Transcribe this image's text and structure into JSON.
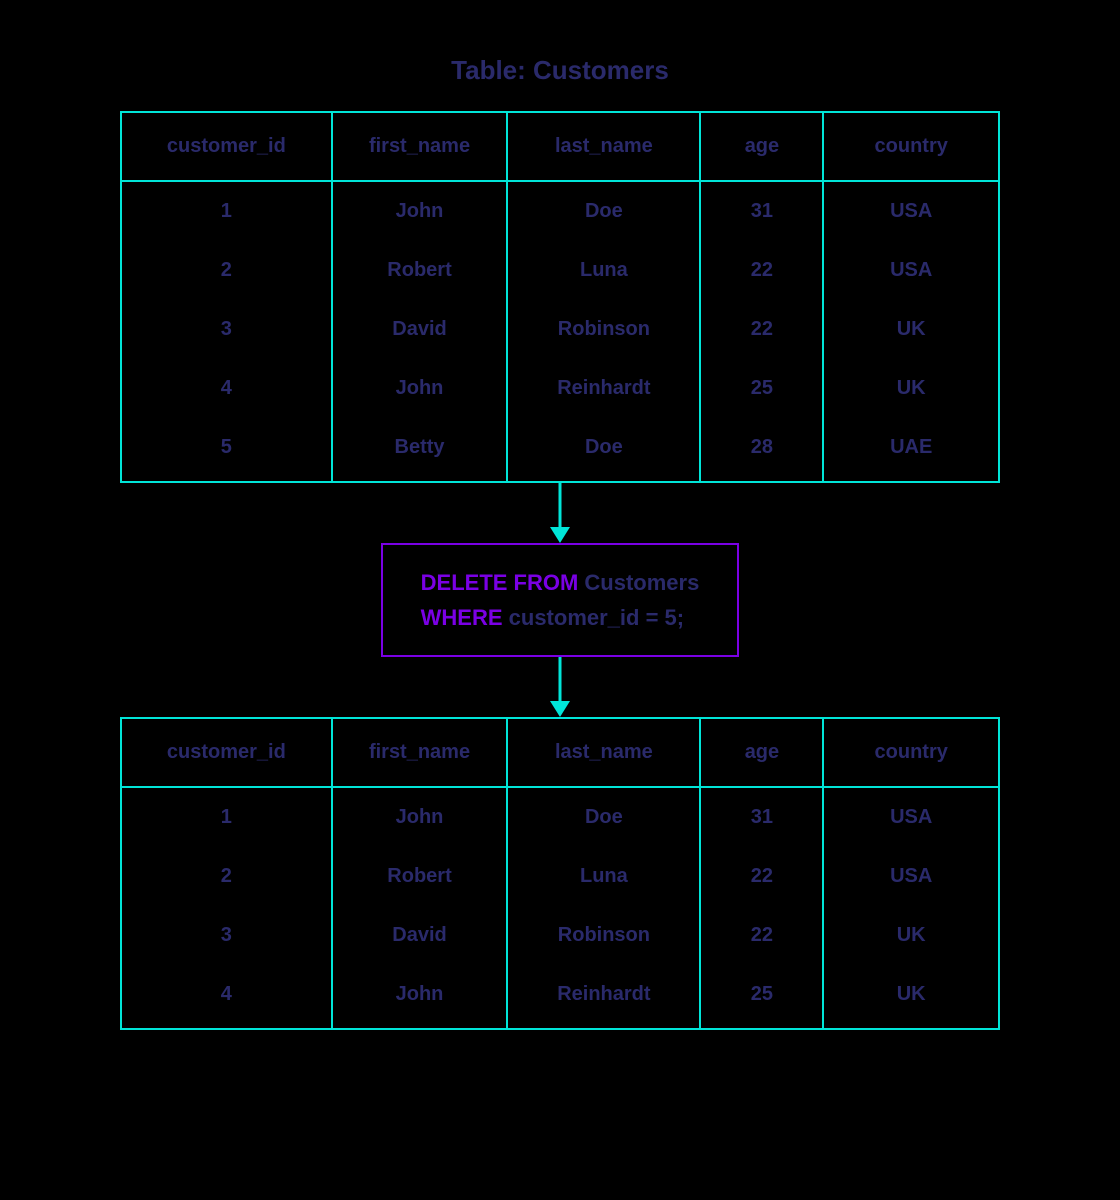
{
  "title": "Table: Customers",
  "columns": [
    "customer_id",
    "first_name",
    "last_name",
    "age",
    "country"
  ],
  "before_rows": [
    {
      "id": "1",
      "first": "John",
      "last": "Doe",
      "age": "31",
      "country": "USA"
    },
    {
      "id": "2",
      "first": "Robert",
      "last": "Luna",
      "age": "22",
      "country": "USA"
    },
    {
      "id": "3",
      "first": "David",
      "last": "Robinson",
      "age": "22",
      "country": "UK"
    },
    {
      "id": "4",
      "first": "John",
      "last": "Reinhardt",
      "age": "25",
      "country": "UK"
    },
    {
      "id": "5",
      "first": "Betty",
      "last": "Doe",
      "age": "28",
      "country": "UAE"
    }
  ],
  "after_rows": [
    {
      "id": "1",
      "first": "John",
      "last": "Doe",
      "age": "31",
      "country": "USA"
    },
    {
      "id": "2",
      "first": "Robert",
      "last": "Luna",
      "age": "22",
      "country": "USA"
    },
    {
      "id": "3",
      "first": "David",
      "last": "Robinson",
      "age": "22",
      "country": "UK"
    },
    {
      "id": "4",
      "first": "John",
      "last": "Reinhardt",
      "age": "25",
      "country": "UK"
    }
  ],
  "sql": {
    "kw1": "DELETE FROM ",
    "t1": "Customers",
    "kw2": "WHERE ",
    "t2": "customer_id = 5;"
  },
  "colors": {
    "border_teal": "#00e5d8",
    "border_purple": "#7a00e5",
    "text_navy": "#2a2a6b"
  }
}
